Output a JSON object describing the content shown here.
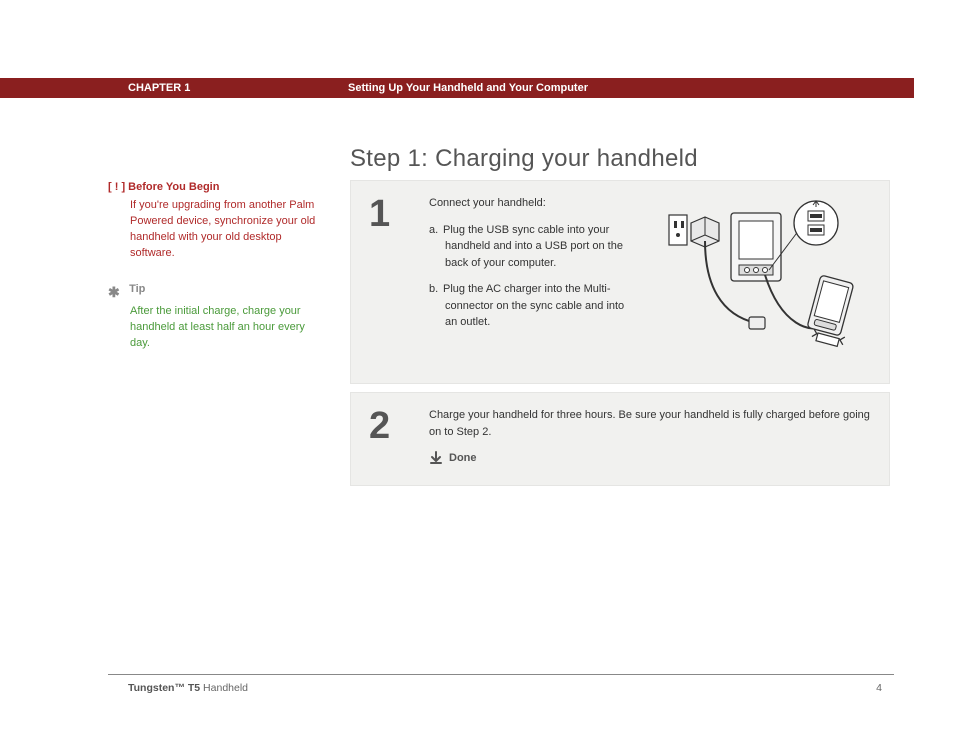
{
  "header": {
    "chapter": "CHAPTER 1",
    "section": "Setting Up Your Handheld and Your Computer"
  },
  "title": "Step 1: Charging your handheld",
  "sidebar": {
    "before": {
      "marker": "[ ! ]",
      "title": "Before You Begin",
      "body": "If you're upgrading from another Palm Powered device, synchronize your old handheld with your old desktop software."
    },
    "tip": {
      "marker": "✱",
      "title": "Tip",
      "body": "After the initial charge, charge your handheld at least half an hour every day."
    }
  },
  "steps": {
    "s1": {
      "num": "1",
      "lead": "Connect your handheld:",
      "a_label": "a.",
      "a": "Plug the USB sync cable into your handheld and into a USB port on the back of your computer.",
      "b_label": "b.",
      "b": "Plug the AC charger into the Multi-connector on the sync cable and into an outlet."
    },
    "s2": {
      "num": "2",
      "body": "Charge your handheld for three hours. Be sure your handheld is fully charged before going on to Step 2.",
      "done": "Done"
    }
  },
  "footer": {
    "product_bold": "Tungsten™ T5",
    "product_rest": " Handheld",
    "page": "4"
  }
}
